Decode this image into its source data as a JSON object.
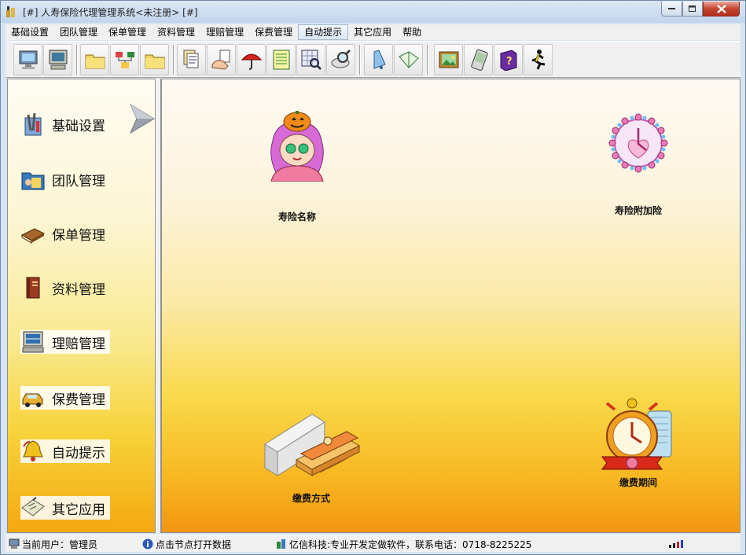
{
  "window": {
    "title": "[#] 人寿保险代理管理系统<未注册> [#]"
  },
  "menu": {
    "items": [
      "基础设置",
      "团队管理",
      "保单管理",
      "资料管理",
      "理赔管理",
      "保费管理",
      "自动提示",
      "其它应用",
      "帮助"
    ],
    "active": "自动提示"
  },
  "toolbar": {
    "icons": [
      "monitor-icon",
      "computer-icon",
      "folder-icon",
      "network-icon",
      "folder-icon",
      "document-stack-icon",
      "hand-document-icon",
      "umbrella-icon",
      "ledger-icon",
      "search-grid-icon",
      "magnifier-icon",
      "bell-icon",
      "open-book-icon",
      "picture-icon",
      "pda-icon",
      "help-book-icon",
      "exit-runner-icon"
    ]
  },
  "nav": {
    "items": [
      {
        "label": "基础设置",
        "icon": "tools-icon"
      },
      {
        "label": "团队管理",
        "icon": "team-folder-icon"
      },
      {
        "label": "保单管理",
        "icon": "policy-book-icon"
      },
      {
        "label": "资料管理",
        "icon": "binder-icon"
      },
      {
        "label": "理赔管理",
        "icon": "claim-computer-icon"
      },
      {
        "label": "保费管理",
        "icon": "car-icon"
      },
      {
        "label": "自动提示",
        "icon": "bell-icon"
      },
      {
        "label": "其它应用",
        "icon": "note-icon"
      }
    ]
  },
  "content": {
    "nodes": [
      {
        "label": "寿险名称",
        "icon": "pumpkin-girl-icon"
      },
      {
        "label": "寿险附加险",
        "icon": "heart-clock-icon"
      },
      {
        "label": "缴费方式",
        "icon": "money-wallet-icon"
      },
      {
        "label": "缴费期间",
        "icon": "alarm-clock-icon"
      }
    ]
  },
  "status": {
    "user": "当前用户：管理员",
    "hint": "点击节点打开数据",
    "company": "亿信科技:专业开发定做软件，联系电话：0718-8225225"
  },
  "colors": {
    "panel_top": "#fefcf3",
    "panel_bottom": "#f5a810",
    "close_button": "#c6442f"
  }
}
